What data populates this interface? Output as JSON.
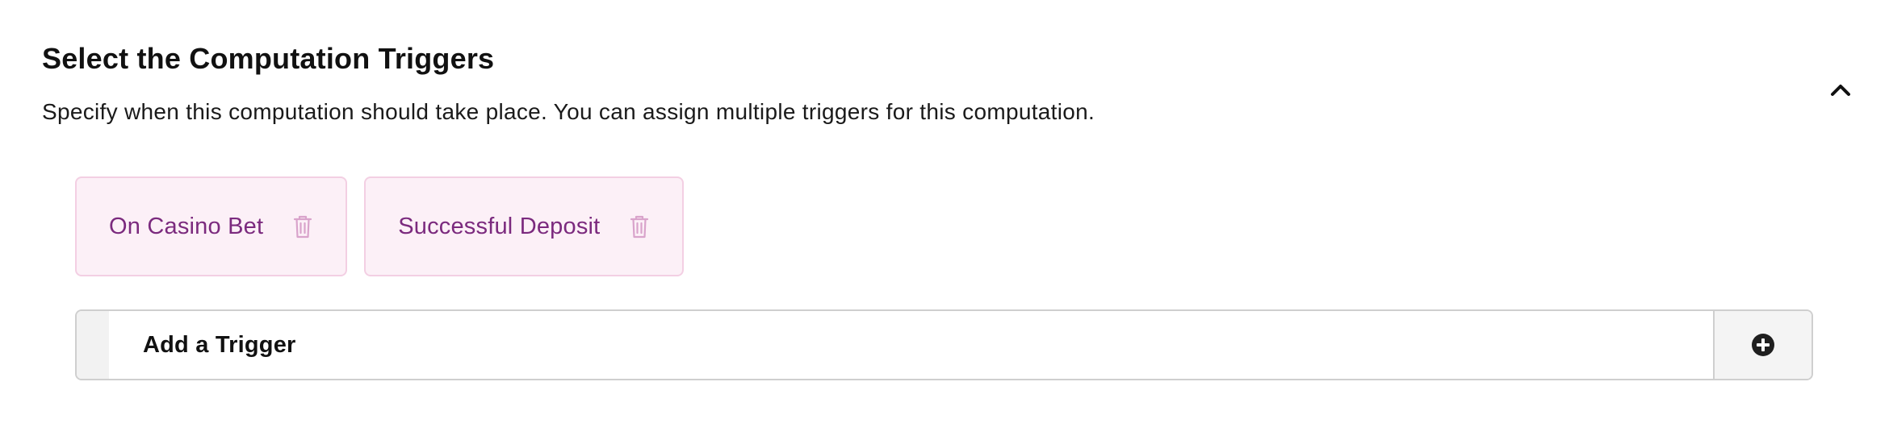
{
  "section": {
    "title": "Select the Computation Triggers",
    "description": "Specify when this computation should take place. You can assign multiple triggers for this computation.",
    "collapse_icon": "chevron-up-icon"
  },
  "selected_triggers": [
    {
      "label": "On Casino Bet",
      "delete_icon": "trash-icon"
    },
    {
      "label": "Successful Deposit",
      "delete_icon": "trash-icon"
    }
  ],
  "add_trigger": {
    "label": "Add a Trigger",
    "icon": "plus-circle-icon"
  },
  "colors": {
    "chip_background": "#fcf0f7",
    "chip_border": "#f3cfe3",
    "chip_text": "#7b2a7e",
    "chip_icon": "#d9a3cb"
  }
}
